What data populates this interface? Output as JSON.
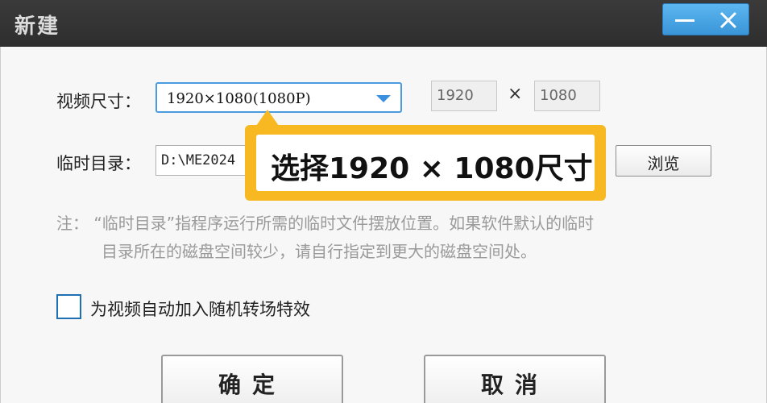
{
  "window": {
    "title": "新建",
    "minimize_icon": "minimize-icon",
    "close_icon": "close-icon"
  },
  "video_size": {
    "label": "视频尺寸：",
    "selected": "1920×1080(1080P)",
    "width": "1920",
    "times": "×",
    "height": "1080"
  },
  "temp_dir": {
    "label": "临时目录：",
    "value": "D:\\ME2024",
    "browse_label": "浏览"
  },
  "callout": {
    "text": "选择1920 × 1080尺寸"
  },
  "note": {
    "line1": "注：  “临时目录”指程序运行所需的临时文件摆放位置。如果软件默认的临时",
    "line2": "目录所在的磁盘空间较少，请自行指定到更大的磁盘空间处。"
  },
  "options": {
    "auto_transition_label": "为视频自动加入随机转场特效",
    "auto_transition_checked": false
  },
  "buttons": {
    "ok_label": "确定",
    "cancel_label": "取消"
  },
  "colors": {
    "titlebar": "#2e2e2e",
    "accent": "#3a95d8",
    "callout": "#f7b822"
  }
}
